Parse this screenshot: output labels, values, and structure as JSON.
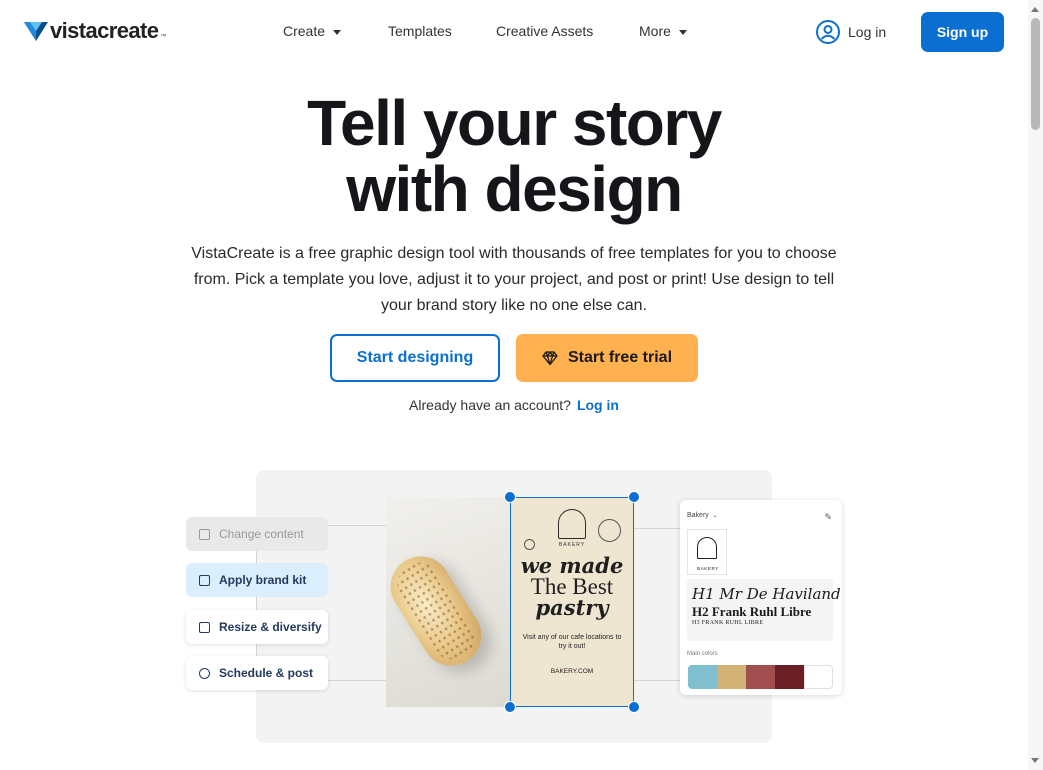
{
  "header": {
    "logo_text": "vistacreate",
    "logo_tm": "™",
    "nav": [
      {
        "label": "Create",
        "has_caret": true
      },
      {
        "label": "Templates",
        "has_caret": false
      },
      {
        "label": "Creative Assets",
        "has_caret": false
      },
      {
        "label": "More",
        "has_caret": true
      }
    ],
    "login_label": "Log in",
    "signup_label": "Sign up",
    "accent_color": "#0b6fd1"
  },
  "hero": {
    "title_line1": "Tell your story",
    "title_line2": "with design",
    "description": "VistaCreate is a free graphic design tool with thousands of free templates for you to choose from. Pick a template you love, adjust it to your project, and post or print! Use design to tell your brand story like no one else can.",
    "start_designing_label": "Start designing",
    "start_trial_label": "Start free trial",
    "already_text": "Already have an account?",
    "already_login_label": "Log in",
    "trial_color": "#ffb04f"
  },
  "illustration": {
    "steps": [
      {
        "label": "Change content",
        "icon": "crop-icon",
        "state": "disabled"
      },
      {
        "label": "Apply brand kit",
        "icon": "briefcase-icon",
        "state": "active"
      },
      {
        "label": "Resize & diversify",
        "icon": "resize-icon",
        "state": "normal"
      },
      {
        "label": "Schedule & post",
        "icon": "clock-icon",
        "state": "normal"
      }
    ],
    "poster": {
      "brand": "BAKERY",
      "headline1": "we made",
      "headline2": "The Best",
      "headline3": "pastry",
      "visit_text": "Visit any of our cafe locations to try it out!",
      "url": "BAKERY.COM"
    },
    "brand_panel": {
      "title": "Bakery",
      "logo_text": "BAKERY",
      "font_h1": "H1 Mr De Haviland",
      "font_h2": "H2 Frank Ruhl Libre",
      "font_h3": "H3 FRANK RUHL LIBRE",
      "colors_label": "Main colors",
      "colors": [
        "#7fbfd0",
        "#d2b275",
        "#a14e4f",
        "#6a1f24",
        "#ffffff"
      ]
    }
  }
}
